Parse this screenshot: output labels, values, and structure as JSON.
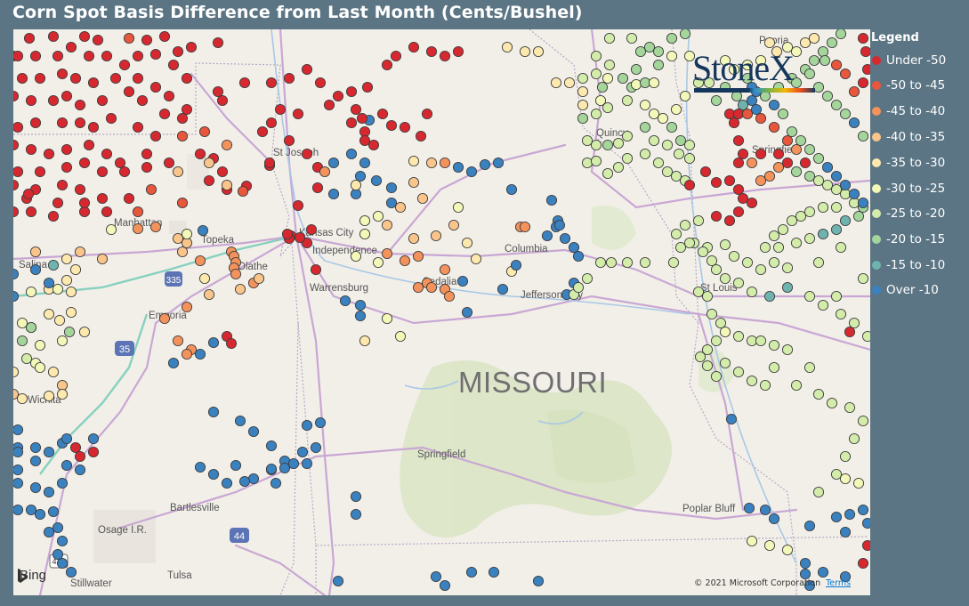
{
  "title": "Corn Spot Basis Difference from Last Month (Cents/Bushel)",
  "legend": {
    "title": "Legend",
    "items": [
      {
        "label": "Under -50",
        "color": "#d7282f"
      },
      {
        "label": "-50 to -45",
        "color": "#e8563b"
      },
      {
        "label": "-45 to -40",
        "color": "#f4925c"
      },
      {
        "label": "-40 to -35",
        "color": "#f9c58b"
      },
      {
        "label": "-35 to -30",
        "color": "#fde9ad"
      },
      {
        "label": "-30 to -25",
        "color": "#f3f7b7"
      },
      {
        "label": "-25 to -20",
        "color": "#d3ecaa"
      },
      {
        "label": "-20 to -15",
        "color": "#a4d59b"
      },
      {
        "label": "-15 to -10",
        "color": "#6fb3ae"
      },
      {
        "label": "Over -10",
        "color": "#3a81c0"
      }
    ]
  },
  "map": {
    "state_label": "MISSOURI",
    "cities": [
      {
        "name": "Peoria"
      },
      {
        "name": "St Joseph"
      },
      {
        "name": "Quincy"
      },
      {
        "name": "Springfield"
      },
      {
        "name": "Manhattan"
      },
      {
        "name": "Topeka"
      },
      {
        "name": "Kansas City"
      },
      {
        "name": "Independence"
      },
      {
        "name": "Columbia"
      },
      {
        "name": "Salina"
      },
      {
        "name": "Olathe"
      },
      {
        "name": "Sedalia"
      },
      {
        "name": "Warrensburg"
      },
      {
        "name": "St Louis"
      },
      {
        "name": "Jefferson City"
      },
      {
        "name": "Emporia"
      },
      {
        "name": "Wichita"
      },
      {
        "name": "Springfield"
      },
      {
        "name": "Bartlesville"
      },
      {
        "name": "Osage I.R."
      },
      {
        "name": "Poplar Bluff"
      },
      {
        "name": "Tulsa"
      },
      {
        "name": "Stillwater"
      }
    ],
    "highways": [
      "335",
      "35",
      "44",
      "412"
    ],
    "logo": "StoneX",
    "attribution": {
      "provider": "Bing",
      "copyright": "© 2021 Microsoft Corporation",
      "terms": "Terms"
    }
  }
}
